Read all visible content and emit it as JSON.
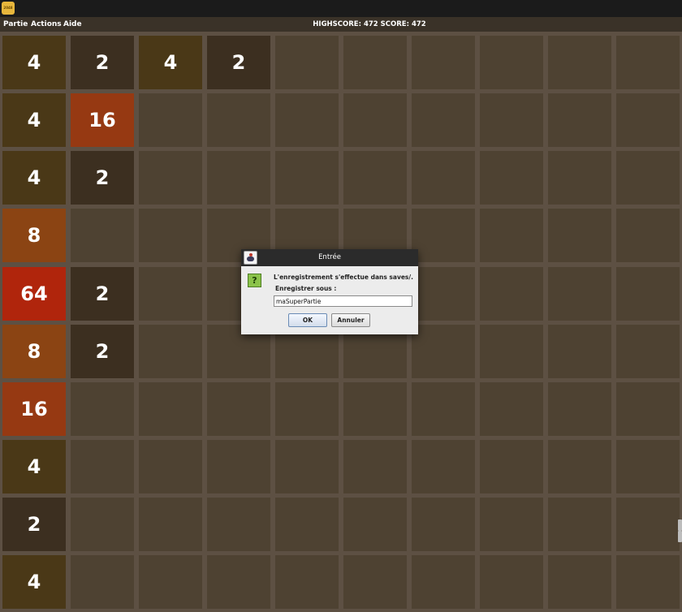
{
  "app": {
    "icon_label": "2048"
  },
  "menu": {
    "items": [
      "Partie",
      "Actions",
      "Aide"
    ]
  },
  "score": {
    "text": "HIGHSCORE: 472 SCORE: 472"
  },
  "colors": {
    "empty": "#4e4232",
    "tile_2": "#3c2f20",
    "tile_4": "#4a3817",
    "tile_8": "#8b4413",
    "tile_16": "#963912",
    "tile_64": "#b0250c"
  },
  "board": {
    "columns": 10,
    "rows": [
      [
        "4",
        "2",
        "4",
        "2",
        "",
        "",
        "",
        "",
        "",
        ""
      ],
      [
        "4",
        "16",
        "",
        "",
        "",
        "",
        "",
        "",
        "",
        ""
      ],
      [
        "4",
        "2",
        "",
        "",
        "",
        "",
        "",
        "",
        "",
        ""
      ],
      [
        "8",
        "",
        "",
        "",
        "",
        "",
        "",
        "",
        "",
        ""
      ],
      [
        "64",
        "2",
        "",
        "",
        "",
        "",
        "",
        "",
        "",
        ""
      ],
      [
        "8",
        "2",
        "",
        "",
        "",
        "",
        "",
        "",
        "",
        ""
      ],
      [
        "16",
        "",
        "",
        "",
        "",
        "",
        "",
        "",
        "",
        ""
      ],
      [
        "4",
        "",
        "",
        "",
        "",
        "",
        "",
        "",
        "",
        ""
      ],
      [
        "2",
        "",
        "",
        "",
        "",
        "",
        "",
        "",
        "",
        ""
      ],
      [
        "4",
        "",
        "",
        "",
        "",
        "",
        "",
        "",
        "",
        ""
      ]
    ]
  },
  "dialog": {
    "title": "Entrée",
    "message": "L'enregistrement s'effectue dans saves/.",
    "label": "Enregistrer sous :",
    "input_value": "maSuperPartie",
    "ok_label": "OK",
    "cancel_label": "Annuler",
    "icon": "question-icon"
  }
}
